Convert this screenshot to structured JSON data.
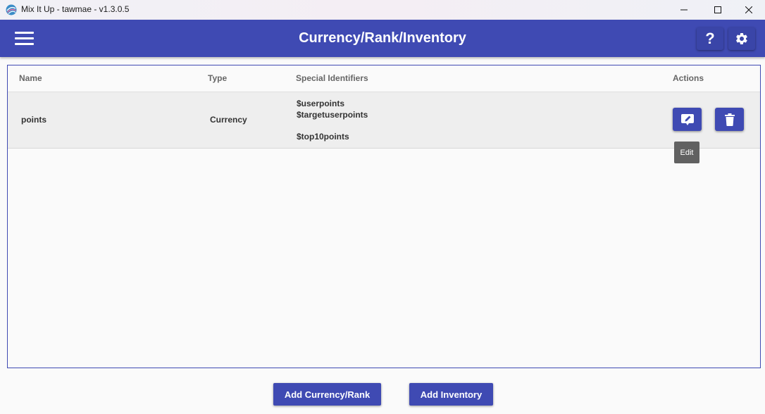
{
  "window": {
    "title": "Mix It Up - tawmae - v1.3.0.5"
  },
  "header": {
    "title": "Currency/Rank/Inventory",
    "help_label": "?"
  },
  "table": {
    "columns": [
      "Name",
      "Type",
      "Special Identifiers",
      "Actions"
    ],
    "rows": [
      {
        "name": "points",
        "type": "Currency",
        "identifiers": [
          "$userpoints",
          "$targetuserpoints",
          "$top10points"
        ]
      }
    ]
  },
  "tooltip": {
    "text": "Edit"
  },
  "buttons": {
    "add_currency": "Add Currency/Rank",
    "add_inventory": "Add Inventory"
  },
  "colors": {
    "primary": "#3f4ab3",
    "tooltip_bg": "#616161"
  },
  "icons": {
    "app_logo": "mixitup-logo-icon",
    "menu": "hamburger-menu-icon",
    "settings": "gear-icon",
    "edit": "pencil-icon",
    "delete": "trash-icon"
  }
}
